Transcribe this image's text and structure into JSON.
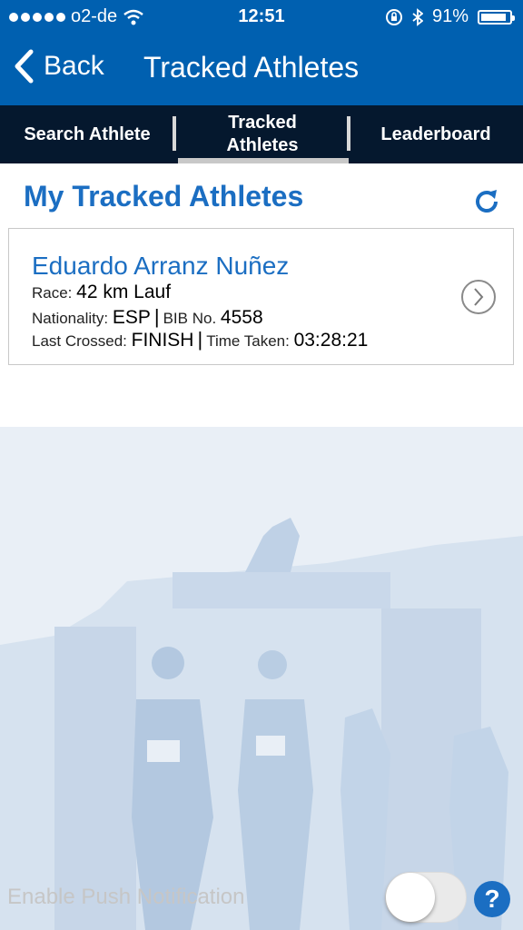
{
  "status_bar": {
    "carrier": "o2-de",
    "time": "12:51",
    "battery": "91%",
    "battery_level": 0.91
  },
  "nav": {
    "back_label": "Back",
    "title": "Tracked Athletes"
  },
  "tabs": [
    {
      "label": "Search Athlete"
    },
    {
      "label": "Tracked Athletes"
    },
    {
      "label": "Leaderboard"
    }
  ],
  "section": {
    "title": "My Tracked Athletes"
  },
  "athlete": {
    "name": "Eduardo Arranz Nuñez",
    "race_label": "Race:",
    "race": "42 km Lauf",
    "nationality_label": "Nationality:",
    "nationality": "ESP",
    "bib_label": "BIB No.",
    "bib": "4558",
    "last_crossed_label": "Last Crossed:",
    "last_crossed": "FINISH",
    "time_taken_label": "Time Taken:",
    "time_taken": "03:28:21"
  },
  "push": {
    "label": "Enable Push Notification",
    "enabled": false
  },
  "help": {
    "label": "?"
  },
  "colors": {
    "primary": "#0060b0",
    "accent": "#1b6ec2",
    "tabbar": "#05182e"
  }
}
